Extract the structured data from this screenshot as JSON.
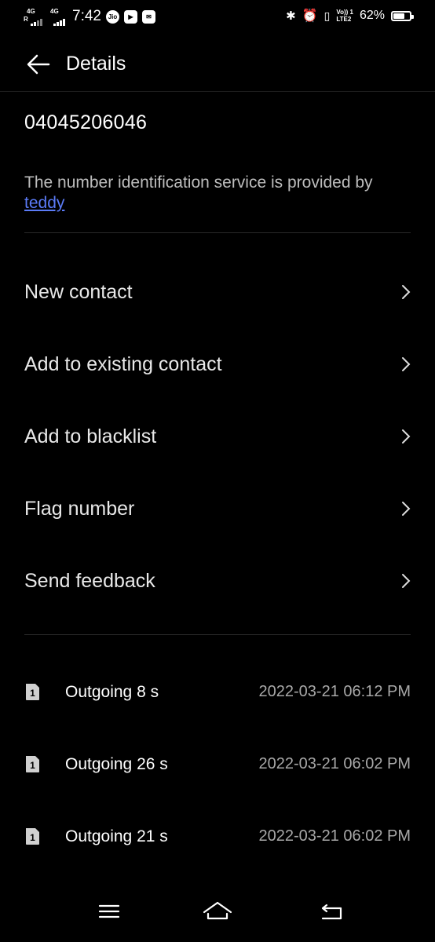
{
  "status_bar": {
    "network1": "4G",
    "network1_sub": "R",
    "network2": "4G",
    "time": "7:42",
    "jio_label": "Jio",
    "volte_top": "Vo)) 1",
    "volte_bottom": "LTE2",
    "battery": "62%",
    "battery_level": 0.62
  },
  "header": {
    "title": "Details"
  },
  "number": "04045206046",
  "provider": {
    "text": "The number identification service is provided by",
    "link": "teddy"
  },
  "menu": [
    {
      "label": "New contact"
    },
    {
      "label": "Add to existing contact"
    },
    {
      "label": "Add to blacklist"
    },
    {
      "label": "Flag number"
    },
    {
      "label": "Send feedback"
    }
  ],
  "calls": [
    {
      "sim": "1",
      "type": "Outgoing 8 s",
      "time": "2022-03-21 06:12 PM"
    },
    {
      "sim": "1",
      "type": "Outgoing 26 s",
      "time": "2022-03-21 06:02 PM"
    },
    {
      "sim": "1",
      "type": "Outgoing 21 s",
      "time": "2022-03-21 06:02 PM"
    }
  ],
  "icons": {
    "back": "arrow-left-icon",
    "chevron": "chevron-right-icon",
    "sim": "sim-card-icon",
    "nav_menu": "menu-icon",
    "nav_home": "home-icon",
    "nav_back": "back-icon"
  },
  "colors": {
    "background": "#000000",
    "link": "#5b7bf7",
    "secondary_text": "#bdbdbd",
    "timestamp": "#a8a8a8"
  }
}
